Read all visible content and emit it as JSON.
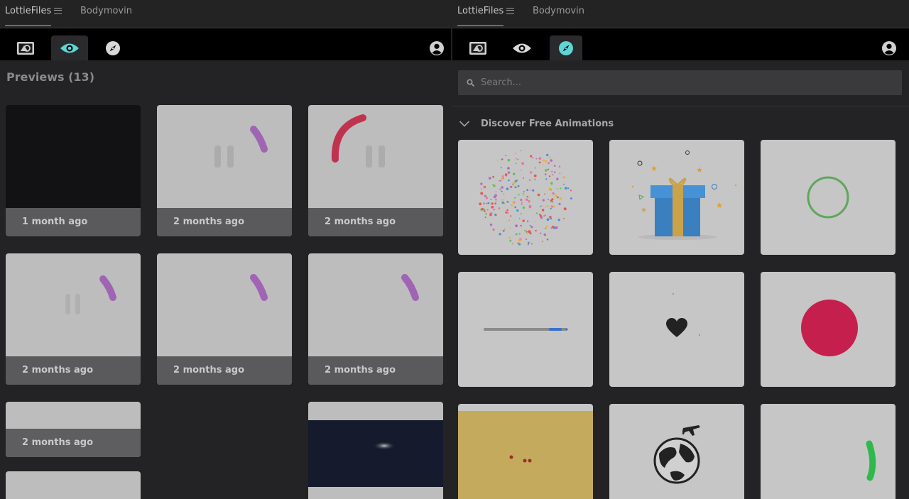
{
  "left": {
    "tabs": [
      {
        "label": "LottieFiles",
        "active": true
      },
      {
        "label": "Bodymovin",
        "active": false
      }
    ],
    "toolbar": {
      "selected": "preview-tool"
    },
    "section_title": "Previews (13)",
    "previews": [
      {
        "time": "1 month ago"
      },
      {
        "time": "2 months ago"
      },
      {
        "time": "2 months ago"
      },
      {
        "time": "2 months ago"
      },
      {
        "time": "2 months ago"
      },
      {
        "time": "2 months ago"
      },
      {
        "time": "2 months ago"
      }
    ]
  },
  "right": {
    "tabs": [
      {
        "label": "LottieFiles",
        "active": true
      },
      {
        "label": "Bodymovin",
        "active": false
      }
    ],
    "toolbar": {
      "selected": "discover-tool"
    },
    "search": {
      "placeholder": "Search..."
    },
    "section_title": "Discover Free Animations"
  },
  "colors": {
    "accent": "#5fd6d6",
    "purple": "#a064b4",
    "crimson": "#c0334f",
    "green": "#5fa65a"
  }
}
